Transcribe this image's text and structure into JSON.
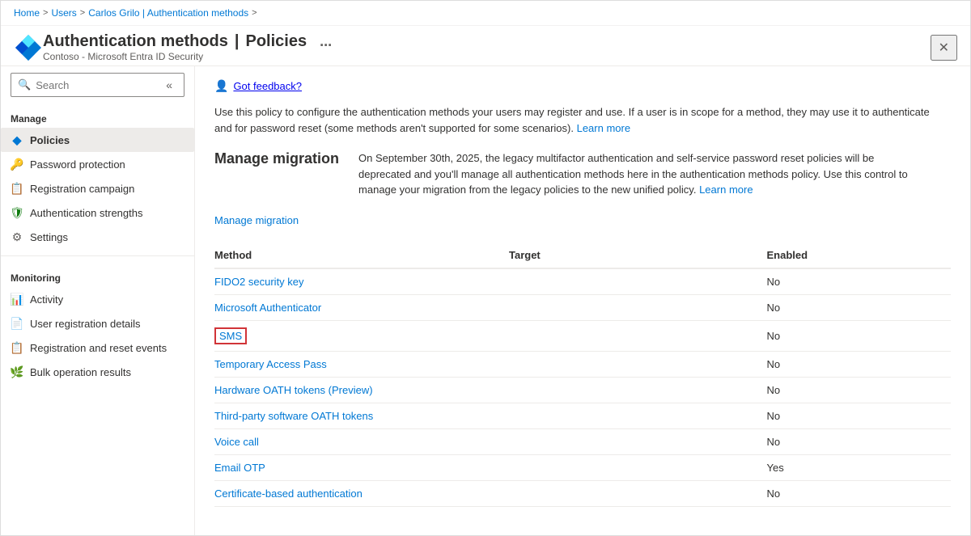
{
  "breadcrumb": {
    "items": [
      "Home",
      "Users",
      "Carlos Grilo | Authentication methods"
    ],
    "separators": [
      ">",
      ">",
      ">"
    ]
  },
  "header": {
    "title": "Authentication methods",
    "separator": "|",
    "page": "Policies",
    "subtitle": "Contoso - Microsoft Entra ID Security",
    "more_label": "...",
    "close_label": "✕"
  },
  "search": {
    "placeholder": "Search"
  },
  "sidebar": {
    "manage_label": "Manage",
    "monitoring_label": "Monitoring",
    "items_manage": [
      {
        "id": "policies",
        "label": "Policies",
        "icon": "◆",
        "active": true
      },
      {
        "id": "password-protection",
        "label": "Password protection",
        "icon": "🔑"
      },
      {
        "id": "registration-campaign",
        "label": "Registration campaign",
        "icon": "📋"
      },
      {
        "id": "auth-strengths",
        "label": "Authentication strengths",
        "icon": "🛡"
      },
      {
        "id": "settings",
        "label": "Settings",
        "icon": "⚙"
      }
    ],
    "items_monitoring": [
      {
        "id": "activity",
        "label": "Activity",
        "icon": "📊"
      },
      {
        "id": "user-registration",
        "label": "User registration details",
        "icon": "📄"
      },
      {
        "id": "registration-events",
        "label": "Registration and reset events",
        "icon": "📋"
      },
      {
        "id": "bulk-operation",
        "label": "Bulk operation results",
        "icon": "🌿"
      }
    ]
  },
  "content": {
    "feedback_label": "Got feedback?",
    "policy_description": "Use this policy to configure the authentication methods your users may register and use. If a user is in scope for a method, they may use it to authenticate and for password reset (some methods aren't supported for some scenarios).",
    "policy_learn_more": "Learn more",
    "manage_migration_heading": "Manage migration",
    "migration_text": "On September 30th, 2025, the legacy multifactor authentication and self-service password reset policies will be deprecated and you'll manage all authentication methods here in the authentication methods policy. Use this control to manage your migration from the legacy policies to the new unified policy.",
    "migration_learn_more": "Learn more",
    "manage_migration_link": "Manage migration",
    "table": {
      "columns": [
        "Method",
        "Target",
        "Enabled"
      ],
      "rows": [
        {
          "method": "FIDO2 security key",
          "target": "",
          "enabled": "No",
          "is_sms": false
        },
        {
          "method": "Microsoft Authenticator",
          "target": "",
          "enabled": "No",
          "is_sms": false
        },
        {
          "method": "SMS",
          "target": "",
          "enabled": "No",
          "is_sms": true
        },
        {
          "method": "Temporary Access Pass",
          "target": "",
          "enabled": "No",
          "is_sms": false
        },
        {
          "method": "Hardware OATH tokens (Preview)",
          "target": "",
          "enabled": "No",
          "is_sms": false
        },
        {
          "method": "Third-party software OATH tokens",
          "target": "",
          "enabled": "No",
          "is_sms": false
        },
        {
          "method": "Voice call",
          "target": "",
          "enabled": "No",
          "is_sms": false
        },
        {
          "method": "Email OTP",
          "target": "",
          "enabled": "Yes",
          "is_sms": false
        },
        {
          "method": "Certificate-based authentication",
          "target": "",
          "enabled": "No",
          "is_sms": false
        }
      ]
    }
  }
}
